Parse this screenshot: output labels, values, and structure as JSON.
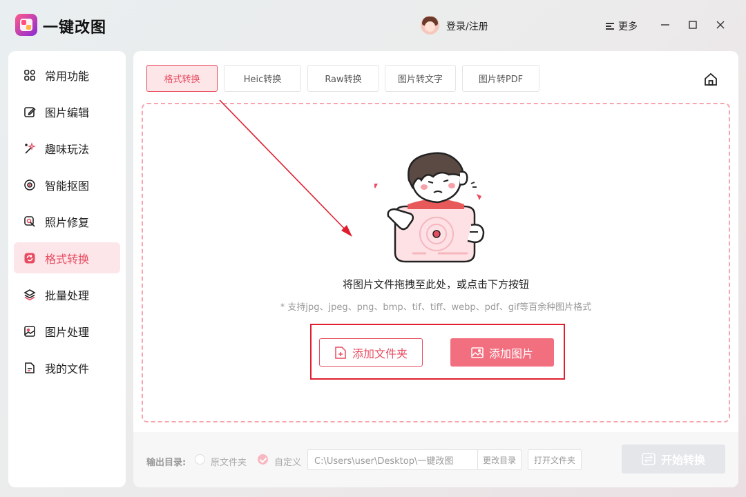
{
  "window": {
    "title": "一键改图",
    "login_label": "登录/注册",
    "more_label": "更多",
    "icons": {
      "logo": "app-logo",
      "avatar": "user-avatar",
      "more": "menu-icon",
      "minimize": "minimize-icon",
      "maximize": "maximize-icon",
      "close": "close-icon"
    }
  },
  "sidebar": {
    "items": [
      {
        "label": "常用功能",
        "icon": "grid-icon",
        "active": false
      },
      {
        "label": "图片编辑",
        "icon": "edit-icon",
        "active": false
      },
      {
        "label": "趣味玩法",
        "icon": "magic-wand-icon",
        "active": false
      },
      {
        "label": "智能抠图",
        "icon": "target-icon",
        "active": false
      },
      {
        "label": "照片修复",
        "icon": "search-repair-icon",
        "active": false
      },
      {
        "label": "格式转换",
        "icon": "convert-icon",
        "active": true
      },
      {
        "label": "批量处理",
        "icon": "layers-icon",
        "active": false
      },
      {
        "label": "图片处理",
        "icon": "image-icon",
        "active": false
      },
      {
        "label": "我的文件",
        "icon": "file-icon",
        "active": false
      }
    ]
  },
  "tabs": [
    {
      "label": "格式转换",
      "active": true
    },
    {
      "label": "Heic转换",
      "active": false
    },
    {
      "label": "Raw转换",
      "active": false
    },
    {
      "label": "图片转文字",
      "active": false
    },
    {
      "label": "图片转PDF",
      "active": false
    }
  ],
  "dropzone": {
    "hint": "将图片文件拖拽至此处，或点击下方按钮",
    "formats": "* 支持jpg、jpeg、png、bmp、tif、tiff、webp、pdf、gif等百余种图片格式",
    "add_folder_label": "添加文件夹",
    "add_image_label": "添加图片"
  },
  "footer": {
    "output_label": "输出目录:",
    "option_original": "原文件夹",
    "option_custom": "自定义",
    "selected_option": "自定义",
    "path_value": "C:\\Users\\user\\Desktop\\一键改图",
    "change_dir_label": "更改目录",
    "open_folder_label": "打开文件夹",
    "start_label": "开始转换"
  },
  "colors": {
    "accent": "#e84c61",
    "accent_light": "#fde6e9",
    "button_primary": "#f26f7f",
    "annotation": "#e01e2f",
    "disabled": "#e4e6ea"
  }
}
